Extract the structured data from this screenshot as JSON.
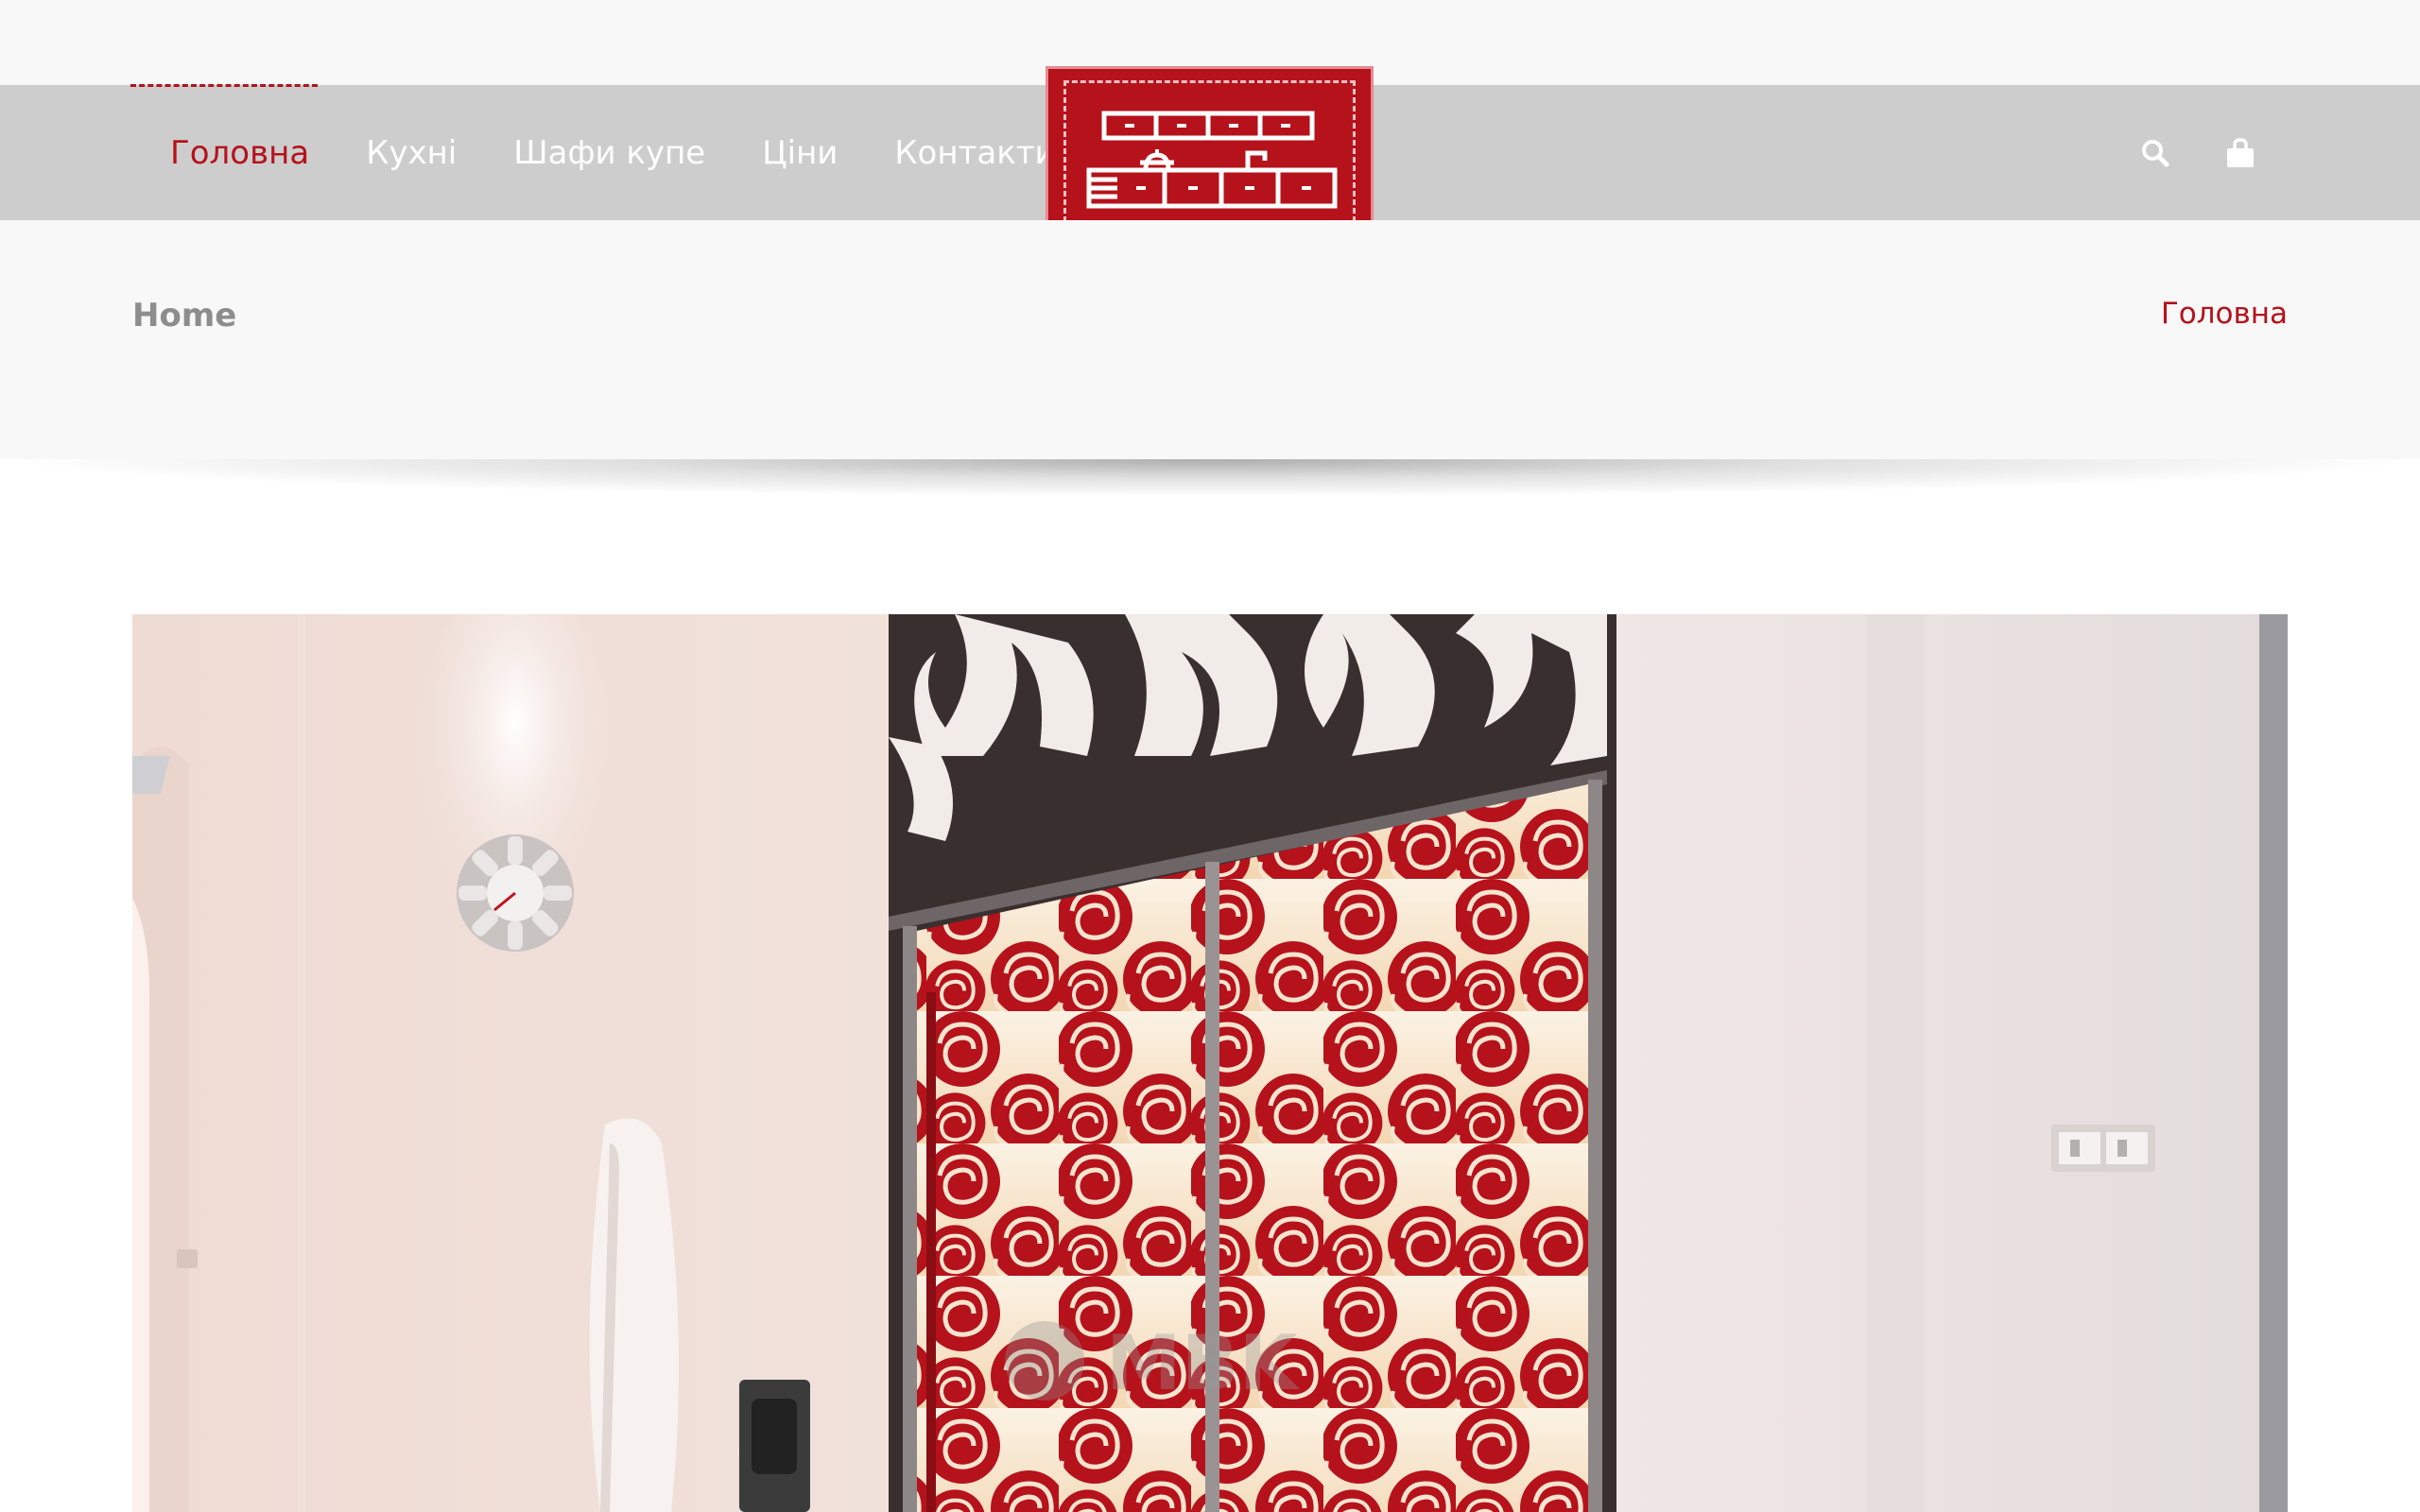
{
  "header": {
    "menu": [
      {
        "label": "Головна",
        "active": true
      },
      {
        "label": "Кухні",
        "active": false
      },
      {
        "label": "Шафи купе",
        "active": false
      },
      {
        "label": "Ціни",
        "active": false
      },
      {
        "label": "Контакти",
        "active": false
      }
    ],
    "icons": [
      "search-icon",
      "shopping-bag-icon"
    ],
    "logo_icon": "kitchen-furniture-logo"
  },
  "title_bar": {
    "page_title": "Home",
    "breadcrumb": "Головна"
  },
  "hero": {
    "image": "sliding-wardrobe-red-roses-photo",
    "watermark": "MBK"
  },
  "colors": {
    "accent": "#b5121b",
    "nav_bg": "#cdcdcd",
    "title_bg": "#f8f8f8",
    "page_title": "#8d8d8d"
  }
}
